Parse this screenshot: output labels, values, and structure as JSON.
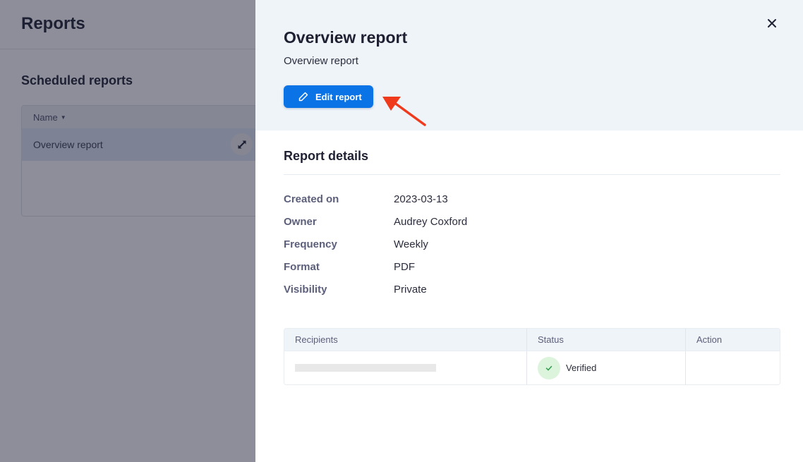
{
  "background": {
    "page_title": "Reports",
    "section_title": "Scheduled reports",
    "table": {
      "column_name": "Name",
      "rows": [
        {
          "name": "Overview report"
        }
      ]
    }
  },
  "drawer": {
    "title": "Overview report",
    "subtitle": "Overview report",
    "edit_button_label": "Edit report",
    "details_title": "Report details",
    "details": [
      {
        "label": "Created on",
        "value": "2023-03-13"
      },
      {
        "label": "Owner",
        "value": "Audrey Coxford"
      },
      {
        "label": "Frequency",
        "value": "Weekly"
      },
      {
        "label": "Format",
        "value": "PDF"
      },
      {
        "label": "Visibility",
        "value": "Private"
      }
    ],
    "recipients_table": {
      "headers": [
        "Recipients",
        "Status",
        "Action"
      ],
      "rows": [
        {
          "recipient": "",
          "status": "Verified",
          "action": ""
        }
      ]
    }
  },
  "colors": {
    "primary": "#0a73e6",
    "annotation_arrow": "#f03a1c",
    "verified_bg": "#dcf3dc",
    "verified_check": "#2e9e4f"
  }
}
